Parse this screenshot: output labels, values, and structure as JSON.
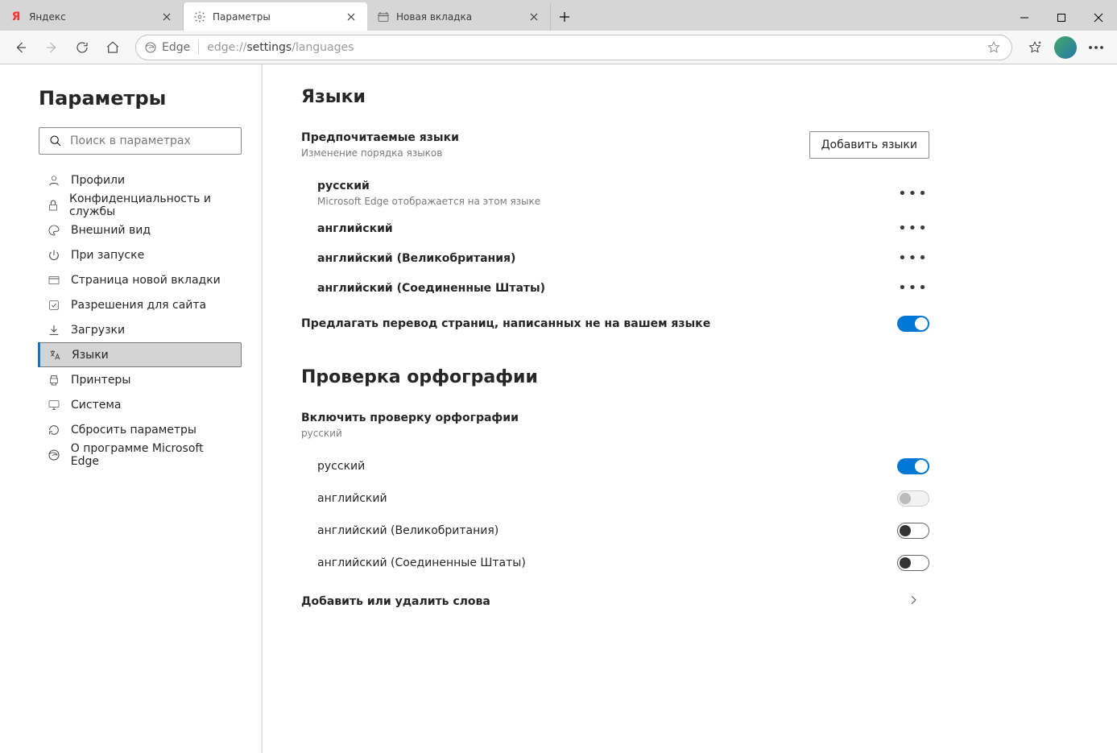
{
  "tabs": [
    {
      "label": "Яндекс"
    },
    {
      "label": "Параметры"
    },
    {
      "label": "Новая вкладка"
    }
  ],
  "address": {
    "brand": "Edge",
    "url_gray1": "edge://",
    "url_dark": "settings",
    "url_gray2": "/languages"
  },
  "sidebar": {
    "title": "Параметры",
    "search_placeholder": "Поиск в параметрах",
    "items": [
      {
        "label": "Профили"
      },
      {
        "label": "Конфиденциальность и службы"
      },
      {
        "label": "Внешний вид"
      },
      {
        "label": "При запуске"
      },
      {
        "label": "Страница новой вкладки"
      },
      {
        "label": "Разрешения для сайта"
      },
      {
        "label": "Загрузки"
      },
      {
        "label": "Языки"
      },
      {
        "label": "Принтеры"
      },
      {
        "label": "Система"
      },
      {
        "label": "Сбросить параметры"
      },
      {
        "label": "О программе Microsoft Edge"
      }
    ]
  },
  "main": {
    "heading1": "Языки",
    "pref_title": "Предпочитаемые языки",
    "pref_desc": "Изменение порядка языков",
    "add_btn": "Добавить языки",
    "langs": [
      {
        "name": "русский",
        "note": "Microsoft Edge отображается на этом языке"
      },
      {
        "name": "английский",
        "note": ""
      },
      {
        "name": "английский (Великобритания)",
        "note": ""
      },
      {
        "name": "английский (Соединенные Штаты)",
        "note": ""
      }
    ],
    "translate_label": "Предлагать перевод страниц, написанных не на вашем языке",
    "heading2": "Проверка орфографии",
    "spell_title": "Включить проверку орфографии",
    "spell_desc": "русский",
    "spell_langs": [
      {
        "name": "русский",
        "state": "on"
      },
      {
        "name": "английский",
        "state": "disabled"
      },
      {
        "name": "английский (Великобритания)",
        "state": "off"
      },
      {
        "name": "английский (Соединенные Штаты)",
        "state": "off"
      }
    ],
    "dict_label": "Добавить или удалить слова"
  }
}
